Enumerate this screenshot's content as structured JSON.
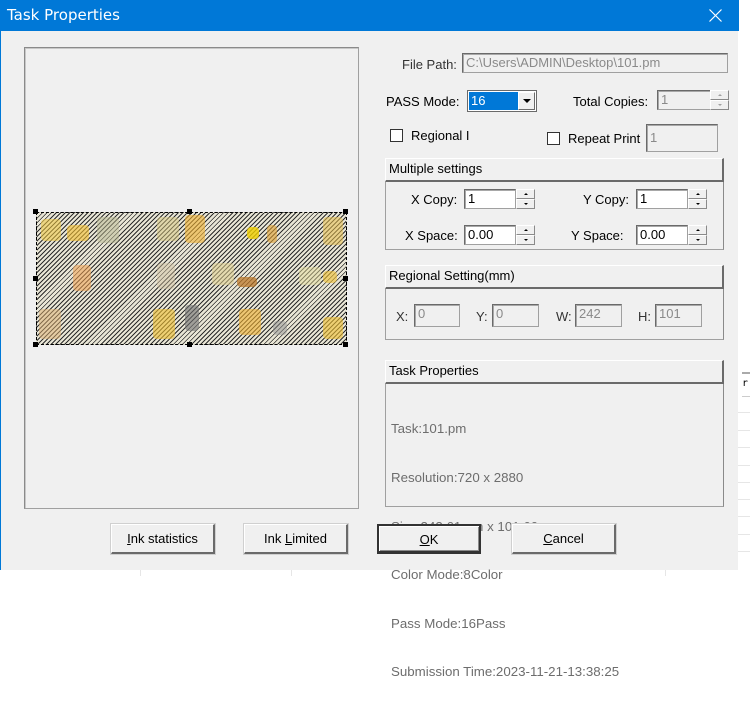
{
  "window": {
    "title": "Task Properties",
    "close_icon": "close-icon"
  },
  "form": {
    "file_path": {
      "label": "File Path:",
      "value": "C:\\Users\\ADMIN\\Desktop\\101.pm",
      "enabled": false
    },
    "pass_mode": {
      "label": "PASS Mode:",
      "value": "16"
    },
    "total_copies": {
      "label": "Total Copies:",
      "value": "1",
      "enabled": false
    },
    "regional": {
      "label": "Regional I",
      "checked": false
    },
    "repeat_print": {
      "label": "Repeat Print",
      "checked": false,
      "value": "1",
      "enabled": false
    }
  },
  "multiple_settings": {
    "header": "Multiple settings",
    "x_copy": {
      "label": "X Copy:",
      "value": "1"
    },
    "y_copy": {
      "label": "Y Copy:",
      "value": "1"
    },
    "x_space": {
      "label": "X Space:",
      "value": "0.00"
    },
    "y_space": {
      "label": "Y Space:",
      "value": "0.00"
    }
  },
  "regional_setting": {
    "header": "Regional Setting(mm)",
    "x": {
      "label": "X:",
      "value": "0"
    },
    "y": {
      "label": "Y:",
      "value": "0"
    },
    "w": {
      "label": "W:",
      "value": "242"
    },
    "h": {
      "label": "H:",
      "value": "101"
    }
  },
  "task_properties": {
    "header": "Task Properties",
    "lines": [
      "Task:101.pm",
      "Resolution:720 x 2880",
      "Size:242.61mm x 101.60mm",
      "Color Mode:8Color",
      "Pass Mode:16Pass",
      "Submission Time:2023-11-21-13:38:25"
    ]
  },
  "buttons": {
    "ink_statistics": {
      "mnemonic": "I",
      "rest": "nk statistics"
    },
    "ink_limited": {
      "pre": "Ink ",
      "mnemonic": "L",
      "rest": "imited"
    },
    "ok": {
      "mnemonic": "O",
      "rest": "K"
    },
    "cancel": {
      "mnemonic": "C",
      "rest": "ancel"
    }
  },
  "colors": {
    "titlebar": "#0078d7",
    "dialog_bg": "#f0f0f0",
    "selection": "#0078d7"
  }
}
